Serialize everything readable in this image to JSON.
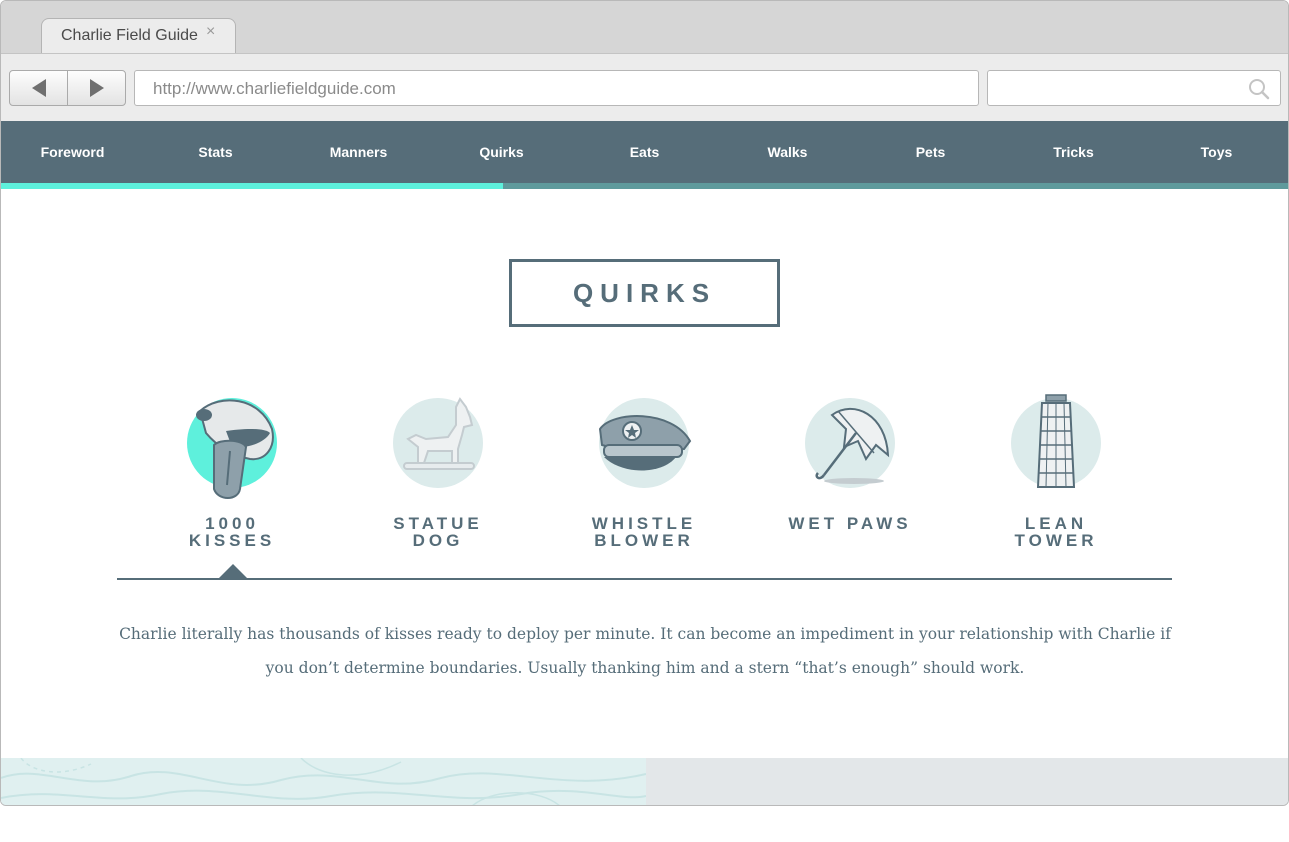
{
  "browser": {
    "tab_title": "Charlie Field Guide",
    "close_symbol": "×",
    "url": "http://www.charliefieldguide.com",
    "search_value": ""
  },
  "nav": {
    "items": [
      "Foreword",
      "Stats",
      "Manners",
      "Quirks",
      "Eats",
      "Walks",
      "Pets",
      "Tricks",
      "Toys"
    ],
    "active": "Quirks",
    "progress": 0.39
  },
  "page": {
    "title": "QUIRKS"
  },
  "quirks": [
    {
      "label": "1000 KISSES",
      "icon": "kiss-icon",
      "selected": true
    },
    {
      "label": "STATUE DOG",
      "icon": "statue-dog-icon"
    },
    {
      "label": "WHISTLE BLOWER",
      "icon": "police-cap-icon"
    },
    {
      "label": "WET PAWS",
      "icon": "umbrella-icon"
    },
    {
      "label": "LEAN TOWER",
      "icon": "leaning-tower-icon"
    }
  ],
  "description": "Charlie literally has thousands of kisses ready to deploy per minute. It can become an impediment in your relationship with Charlie if you don’t determine boundaries. Usually thanking him and a stern “that’s enough” should work.",
  "colors": {
    "nav_bg": "#566d79",
    "accent": "#5ef0dc",
    "icon_circle": "#dcebeb",
    "text": "#566d79"
  }
}
